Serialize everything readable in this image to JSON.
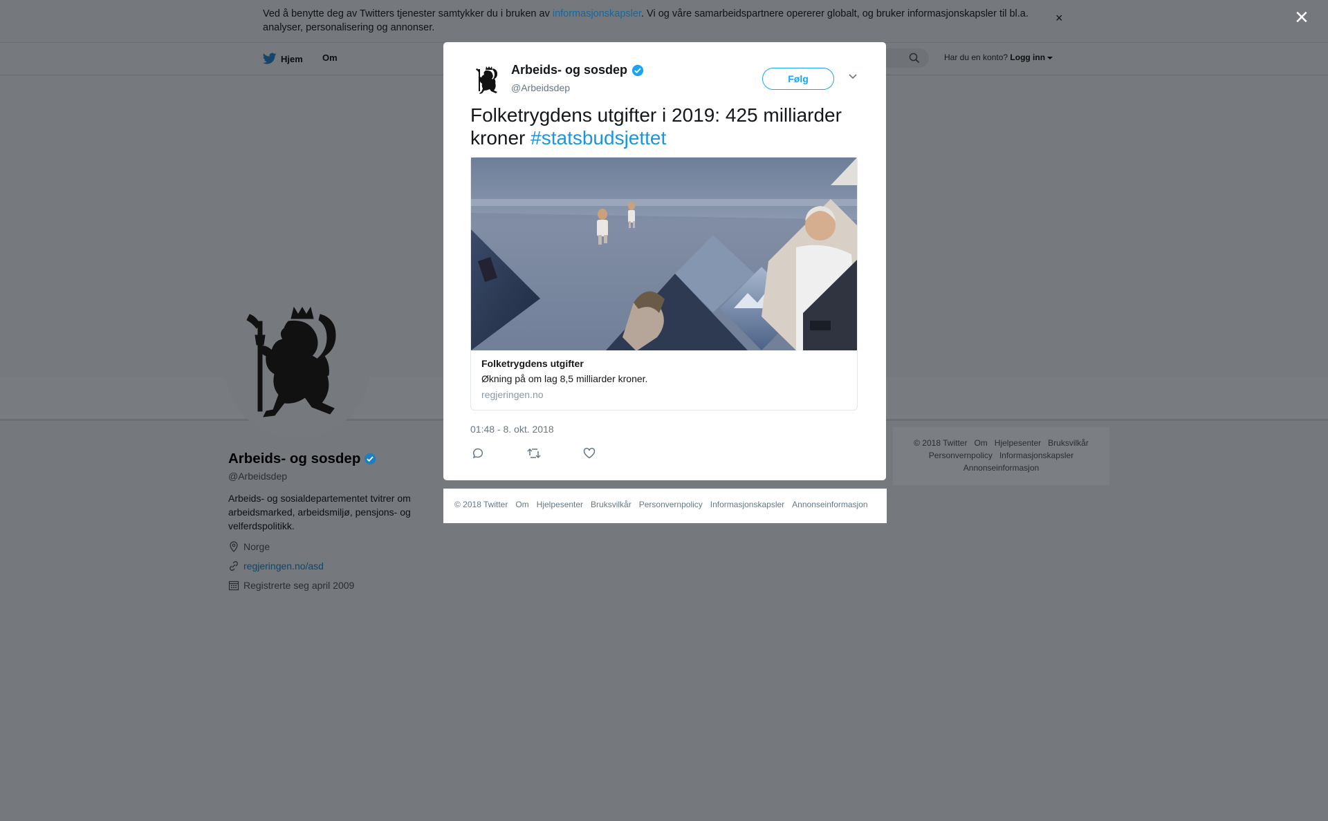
{
  "cookie_banner": {
    "text_before": "Ved å benytte deg av Twitters tjenester samtykker du i bruken av ",
    "link": "informasjonskapsler",
    "text_after": ". Vi og våre samarbeidspartnere opererer globalt, og bruker informasjonskapsler til bl.a. analyser, personalisering og annonser.",
    "close": "×"
  },
  "overlay_close": "×",
  "nav": {
    "home": "Hjem",
    "about": "Om",
    "account_question": "Har du en konto?",
    "login": "Logg inn"
  },
  "profile": {
    "name": "Arbeids- og sosdep",
    "handle": "@Arbeidsdep",
    "bio": "Arbeids- og sosialdepartementet tvitrer om arbeidsmarked, arbeidsmiljø, pensjons- og velferdspolitikk.",
    "location": "Norge",
    "website": "regjeringen.no/asd",
    "joined": "Registrerte seg april 2009"
  },
  "right_footer": {
    "items": [
      "© 2018 Twitter",
      "Om",
      "Hjelpesenter",
      "Bruksvilkår",
      "Personvernpolicy",
      "Informasjonskapsler",
      "Annonseinformasjon"
    ]
  },
  "tweet": {
    "author_name": "Arbeids- og sosdep",
    "author_handle": "@Arbeidsdep",
    "follow": "Følg",
    "text": "Folketrygdens utgifter i 2019: 425 milliarder kroner ",
    "hashtag": "#statsbudsjettet",
    "card": {
      "title": "Folketrygdens utgifter",
      "description": "Økning på om lag 8,5 milliarder kroner.",
      "domain": "regjeringen.no"
    },
    "timestamp": "01:48 - 8. okt. 2018"
  },
  "modal_footer": {
    "items": [
      "© 2018 Twitter",
      "Om",
      "Hjelpesenter",
      "Bruksvilkår",
      "Personvernpolicy",
      "Informasjonskapsler",
      "Annonseinformasjon"
    ]
  },
  "colors": {
    "accent": "#1da1f2",
    "hashtag": "#1b95e0",
    "overlay": "#75787c"
  },
  "icons": [
    "twitter-bird-icon",
    "search-icon",
    "verified-badge-icon",
    "chevron-down-icon",
    "reply-icon",
    "retweet-icon",
    "like-icon",
    "location-icon",
    "link-icon",
    "calendar-icon",
    "close-icon"
  ]
}
